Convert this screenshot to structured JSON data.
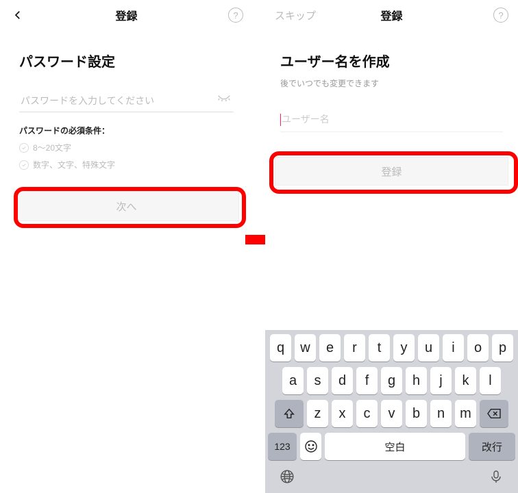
{
  "left": {
    "header_title": "登録",
    "heading": "パスワード設定",
    "password_placeholder": "パスワードを入力してください",
    "requirements_title": "パスワードの必須条件：",
    "requirements": [
      "8～20文字",
      "数字、文字、特殊文字"
    ],
    "next_button": "次へ"
  },
  "right": {
    "skip_label": "スキップ",
    "header_title": "登録",
    "heading": "ユーザー名を作成",
    "subheading": "後でいつでも変更できます",
    "username_placeholder": "ユーザー名",
    "register_button": "登録"
  },
  "keyboard": {
    "row1": [
      "q",
      "w",
      "e",
      "r",
      "t",
      "y",
      "u",
      "i",
      "o",
      "p"
    ],
    "row2": [
      "a",
      "s",
      "d",
      "f",
      "g",
      "h",
      "j",
      "k",
      "l"
    ],
    "row3": [
      "z",
      "x",
      "c",
      "v",
      "b",
      "n",
      "m"
    ],
    "num_key": "123",
    "space_label": "空白",
    "enter_label": "改行"
  }
}
